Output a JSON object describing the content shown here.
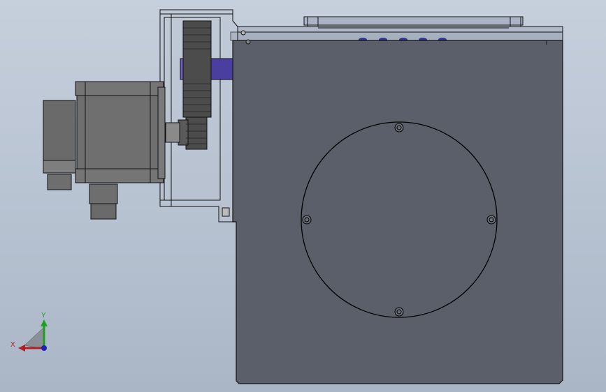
{
  "viewport": {
    "background_top": "#c6cfdc",
    "background_bottom": "#aab6c6"
  },
  "model": {
    "housing_color": "#5a5f6a",
    "motor_color": "#6e6f6e",
    "gear_color": "#4c4c4c",
    "shaft_color": "#4b3ea1",
    "bolt_color": "#2f3690",
    "edge_color": "#111111"
  },
  "triad": {
    "x_label": "X",
    "y_label": "Y",
    "x_color": "#b02020",
    "y_color": "#1aa01a",
    "z_color": "#2020c0"
  }
}
